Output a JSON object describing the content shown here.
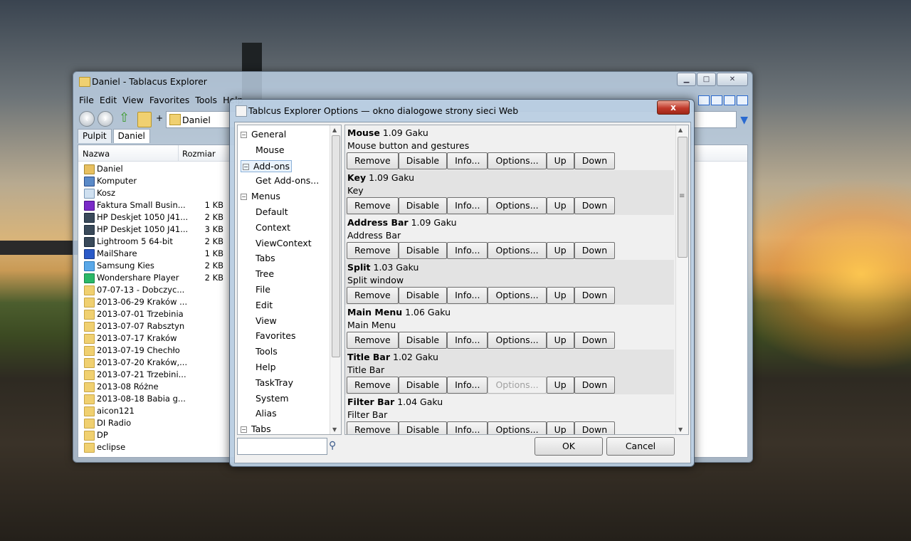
{
  "explorer": {
    "title": "Daniel - Tablacus Explorer",
    "menu": [
      "File",
      "Edit",
      "View",
      "Favorites",
      "Tools",
      "Help"
    ],
    "address": "Daniel",
    "address_plus": "+",
    "tabs": [
      "Pulpit",
      "Daniel"
    ],
    "columns": {
      "name": "Nazwa",
      "size": "Rozmiar"
    },
    "files": [
      {
        "name": "Daniel",
        "size": "",
        "icon": "user"
      },
      {
        "name": "Komputer",
        "size": "",
        "icon": "computer"
      },
      {
        "name": "Kosz",
        "size": "",
        "icon": "bin"
      },
      {
        "name": "Faktura Small Busin...",
        "size": "1 KB",
        "icon": "app1"
      },
      {
        "name": "HP Deskjet 1050 J41...",
        "size": "2 KB",
        "icon": "app2"
      },
      {
        "name": "HP Deskjet 1050 J41...",
        "size": "3 KB",
        "icon": "app2"
      },
      {
        "name": "Lightroom 5 64-bit",
        "size": "2 KB",
        "icon": "app2"
      },
      {
        "name": "MailShare",
        "size": "1 KB",
        "icon": "app3"
      },
      {
        "name": "Samsung Kies",
        "size": "2 KB",
        "icon": "app4"
      },
      {
        "name": "Wondershare Player",
        "size": "2 KB",
        "icon": "app5"
      },
      {
        "name": "07-07-13 - Dobczyc...",
        "size": "",
        "icon": "folder"
      },
      {
        "name": "2013-06-29 Kraków ...",
        "size": "",
        "icon": "folder"
      },
      {
        "name": "2013-07-01 Trzebinia",
        "size": "",
        "icon": "folder"
      },
      {
        "name": "2013-07-07 Rabsztyn",
        "size": "",
        "icon": "folder"
      },
      {
        "name": "2013-07-17 Kraków",
        "size": "",
        "icon": "folder"
      },
      {
        "name": "2013-07-19 Chechło",
        "size": "",
        "icon": "folder"
      },
      {
        "name": "2013-07-20 Kraków,...",
        "size": "",
        "icon": "folder"
      },
      {
        "name": "2013-07-21 Trzebini...",
        "size": "",
        "icon": "folder"
      },
      {
        "name": "2013-08 Różne",
        "size": "",
        "icon": "folder"
      },
      {
        "name": "2013-08-18 Babia g...",
        "size": "",
        "icon": "folder"
      },
      {
        "name": "aicon121",
        "size": "",
        "icon": "folder"
      },
      {
        "name": "DI Radio",
        "size": "",
        "icon": "folder"
      },
      {
        "name": "DP",
        "size": "",
        "icon": "folder"
      },
      {
        "name": "eclipse",
        "size": "",
        "icon": "folder"
      }
    ],
    "right_column_text": "KB"
  },
  "dialog": {
    "title": "Tablcus Explorer Options — okno dialogowe strony sieci Web",
    "close_label": "x",
    "tree": [
      {
        "label": "General",
        "level": 0,
        "expander": "−"
      },
      {
        "label": "Mouse",
        "level": 1
      },
      {
        "label": "Add-ons",
        "level": 0,
        "expander": "−",
        "selected": true
      },
      {
        "label": "Get Add-ons...",
        "level": 1
      },
      {
        "label": "Menus",
        "level": 0,
        "expander": "−"
      },
      {
        "label": "Default",
        "level": 1
      },
      {
        "label": "Context",
        "level": 1
      },
      {
        "label": "ViewContext",
        "level": 1
      },
      {
        "label": "Tabs",
        "level": 1
      },
      {
        "label": "Tree",
        "level": 1
      },
      {
        "label": "File",
        "level": 1
      },
      {
        "label": "Edit",
        "level": 1
      },
      {
        "label": "View",
        "level": 1
      },
      {
        "label": "Favorites",
        "level": 1
      },
      {
        "label": "Tools",
        "level": 1
      },
      {
        "label": "Help",
        "level": 1
      },
      {
        "label": "TaskTray",
        "level": 1
      },
      {
        "label": "System",
        "level": 1
      },
      {
        "label": "Alias",
        "level": 1
      },
      {
        "label": "Tabs",
        "level": 0,
        "expander": "−"
      }
    ],
    "buttons": {
      "remove": "Remove",
      "disable": "Disable",
      "info": "Info...",
      "options": "Options...",
      "up": "Up",
      "down": "Down"
    },
    "addons": [
      {
        "name": "Mouse",
        "version": "1.09 Gaku",
        "description": "Mouse button and gestures",
        "options_enabled": true
      },
      {
        "name": "Key",
        "version": "1.09 Gaku",
        "description": "Key",
        "options_enabled": true
      },
      {
        "name": "Address Bar",
        "version": "1.09 Gaku",
        "description": "Address Bar",
        "options_enabled": true
      },
      {
        "name": "Split",
        "version": "1.03 Gaku",
        "description": "Split window",
        "options_enabled": true
      },
      {
        "name": "Main Menu",
        "version": "1.06 Gaku",
        "description": "Main Menu",
        "options_enabled": true
      },
      {
        "name": "Title Bar",
        "version": "1.02 Gaku",
        "description": "Title Bar",
        "options_enabled": false
      },
      {
        "name": "Filter Bar",
        "version": "1.04 Gaku",
        "description": "Filter Bar",
        "options_enabled": true
      }
    ],
    "search_placeholder": "",
    "ok_label": "OK",
    "cancel_label": "Cancel"
  }
}
